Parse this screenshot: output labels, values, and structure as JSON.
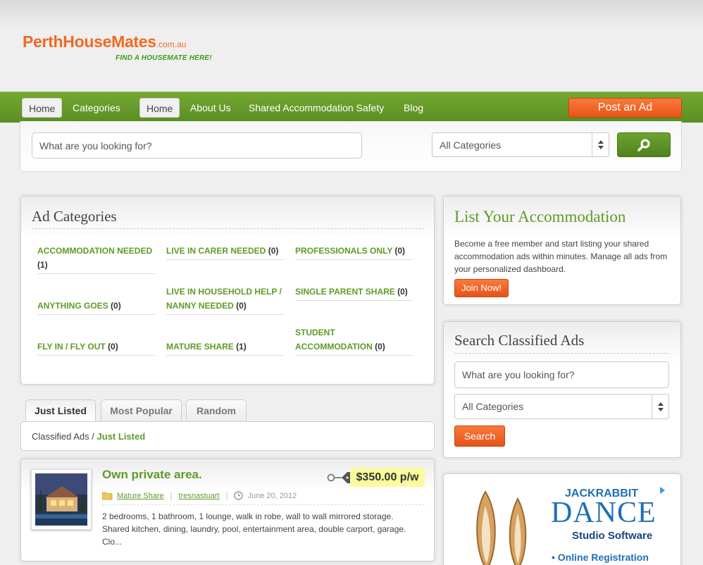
{
  "logo": {
    "main": "PerthHouseMates",
    "tld": ".com.au",
    "tagline": "FIND A HOUSEMATE HERE!"
  },
  "nav": {
    "items": [
      "Home",
      "Categories",
      "Home",
      "About Us",
      "Shared Accommodation Safety",
      "Blog"
    ],
    "post_ad": "Post an Ad"
  },
  "search": {
    "placeholder": "What are you looking for?",
    "category": "All Categories"
  },
  "ad_categories": {
    "title": "Ad Categories",
    "items": [
      {
        "name": "ACCOMMODATION NEEDED",
        "count": "(1)"
      },
      {
        "name": "LIVE IN CARER NEEDED",
        "count": "(0)"
      },
      {
        "name": "PROFESSIONALS ONLY",
        "count": "(0)"
      },
      {
        "name": "ANYTHING GOES",
        "count": "(0)"
      },
      {
        "name": "LIVE IN HOUSEHOLD HELP / NANNY NEEDED",
        "count": "(0)"
      },
      {
        "name": "SINGLE PARENT SHARE",
        "count": "(0)"
      },
      {
        "name": "FLY IN / FLY OUT",
        "count": "(0)"
      },
      {
        "name": "MATURE SHARE",
        "count": "(1)"
      },
      {
        "name": "STUDENT ACCOMMODATION",
        "count": "(0)"
      }
    ]
  },
  "tabs": [
    "Just Listed",
    "Most Popular",
    "Random"
  ],
  "breadcrumb": {
    "root": "Classified Ads",
    "sep": "/",
    "current": "Just Listed"
  },
  "listing": {
    "title": "Own private area.",
    "price": "$350.00 p/w",
    "category": "Mature Share",
    "author": "tresnastuart",
    "date": "June 20, 2012",
    "excerpt": "2 bedrooms, 1 bathroom, 1 lounge, walk in robe, wall to wall mirrored storage. Shared kitchen, dining, laundry, pool, entertainment area, double carport, garage. Clo..."
  },
  "list_accommodation": {
    "title": "List Your Accommodation",
    "text": "Become a free member and start listing your shared accommodation ads within minutes. Manage all ads from your personalized dashboard.",
    "button": "Join Now!"
  },
  "search_classified": {
    "title": "Search Classified Ads",
    "placeholder": "What are you looking for?",
    "category": "All Categories",
    "button": "Search"
  },
  "ad_banner": {
    "brand": "JACKRABBIT",
    "big": "DANCE",
    "sub": "Studio Software",
    "bullet": "• Online Registration"
  },
  "colors": {
    "green": "#5f9a27",
    "orange": "#f06a23",
    "nav": "#66992a"
  }
}
